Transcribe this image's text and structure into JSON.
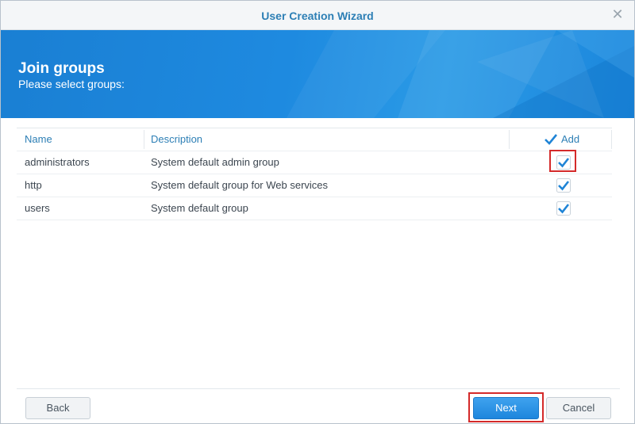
{
  "window": {
    "title": "User Creation Wizard"
  },
  "banner": {
    "title": "Join groups",
    "subtitle": "Please select groups:"
  },
  "table": {
    "headers": {
      "name": "Name",
      "description": "Description",
      "add": "Add"
    },
    "rows": [
      {
        "name": "administrators",
        "description": "System default admin group",
        "checked": true
      },
      {
        "name": "http",
        "description": "System default group for Web services",
        "checked": true
      },
      {
        "name": "users",
        "description": "System default group",
        "checked": true
      }
    ]
  },
  "buttons": {
    "back": "Back",
    "next": "Next",
    "cancel": "Cancel"
  },
  "colors": {
    "accent": "#2d7fb5",
    "banner": "#1e8ae0",
    "highlight": "#d42a2a"
  }
}
